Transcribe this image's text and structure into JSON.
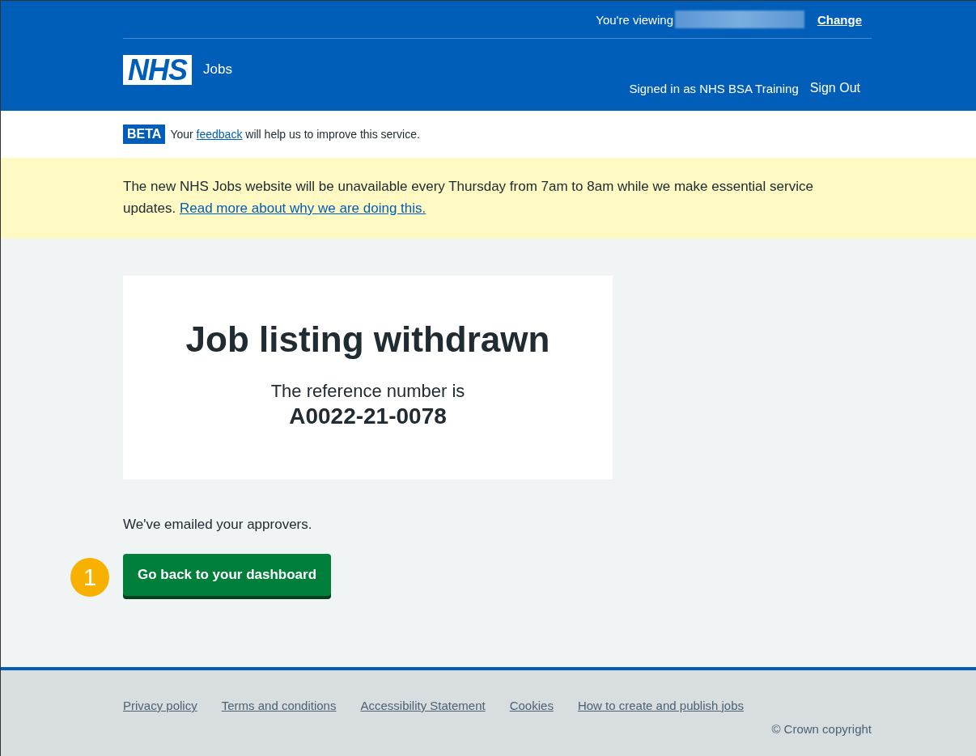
{
  "header": {
    "viewing_label": "You're viewing",
    "change_link": "Change",
    "logo": "NHS",
    "service_name": "Jobs",
    "signed_in": "Signed in as NHS BSA Training",
    "sign_out": "Sign Out"
  },
  "beta_banner": {
    "tag": "BETA",
    "text_before": "Your",
    "link": "feedback",
    "text_after": "will help us to improve this service."
  },
  "notice": {
    "text": "The new NHS Jobs website will be unavailable every Thursday from 7am to 8am while we make essential service updates.",
    "link": "Read more about why we are doing this."
  },
  "panel": {
    "title": "Job listing withdrawn",
    "body": "The reference number is",
    "reference": "A0022-21-0078"
  },
  "message": "We've emailed your approvers.",
  "callout": "1",
  "button": "Go back to your dashboard",
  "footer": {
    "links": [
      "Privacy policy",
      "Terms and conditions",
      "Accessibility Statement",
      "Cookies",
      "How to create and publish jobs"
    ],
    "copyright": "© Crown copyright"
  }
}
